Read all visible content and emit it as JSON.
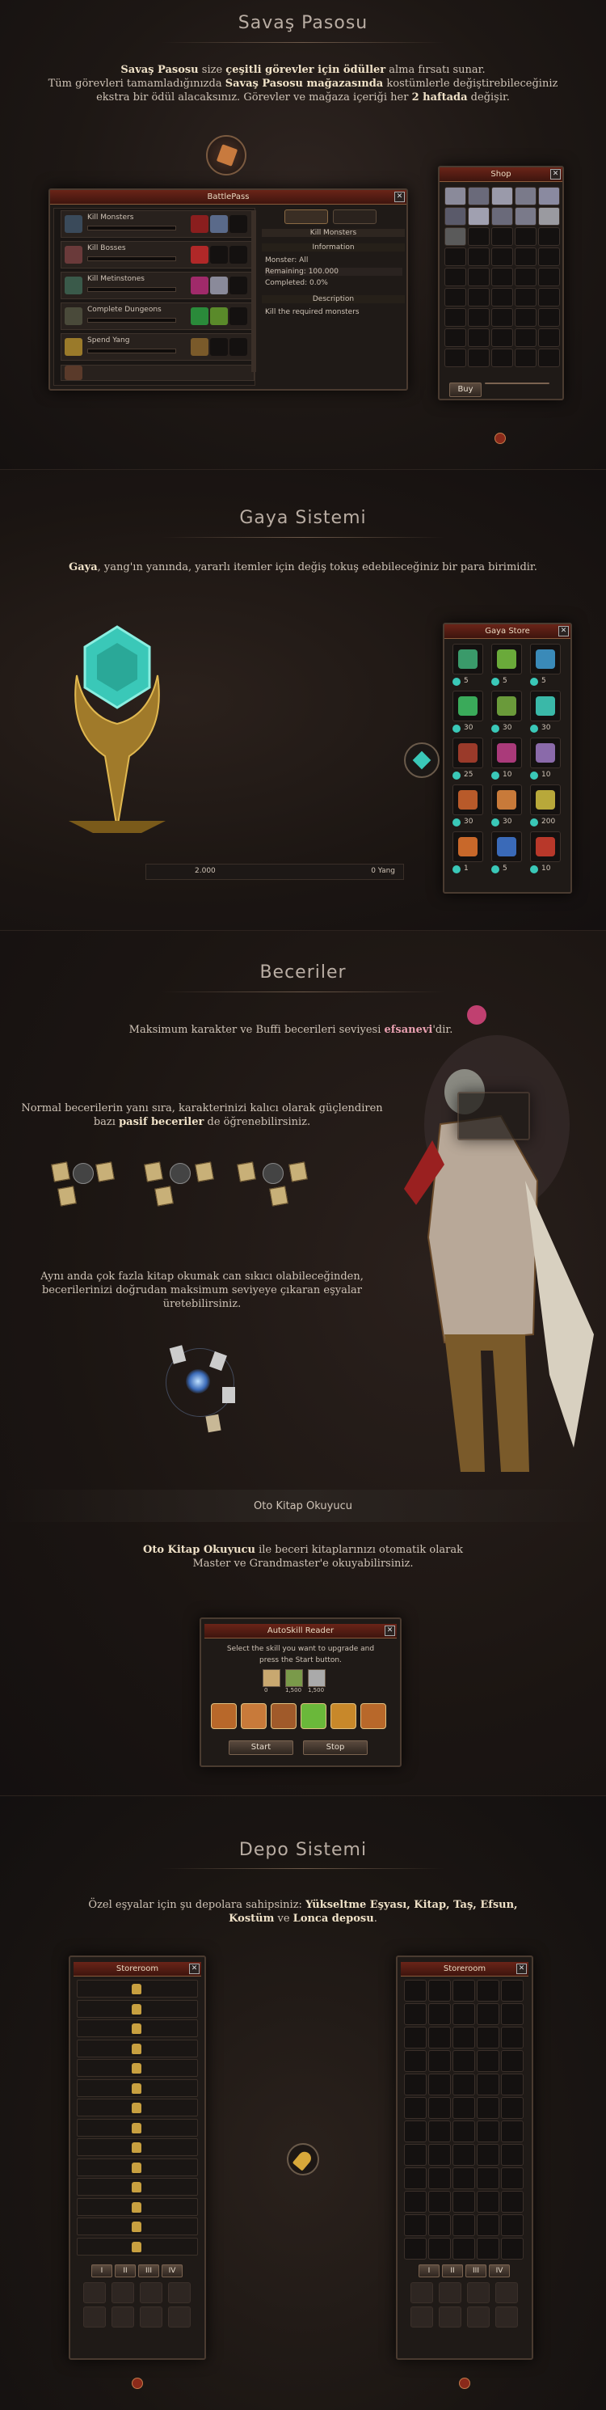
{
  "battlepass": {
    "heading": "Savaş Pasosu",
    "desc_line1_a": "Savaş Pasosu",
    "desc_line1_b": " size ",
    "desc_line1_c": "çeşitli görevler için ödüller",
    "desc_line1_d": " alma fırsatı sunar.",
    "desc_line2_a": "Tüm görevleri tamamladığınızda ",
    "desc_line2_b": "Savaş Pasosu mağazasında",
    "desc_line2_c": " kostümlerle değiştirebileceğiniz",
    "desc_line3_a": "ekstra bir ödül alacaksınız. Görevler ve mağaza içeriği her ",
    "desc_line3_b": "2 haftada",
    "desc_line3_c": " değişir.",
    "window_title": "BattlePass",
    "tasks": [
      "Kill Monsters",
      "Kill Bosses",
      "Kill Metinstones",
      "Complete Dungeons",
      "Spend Yang"
    ],
    "detail_header": "Kill Monsters",
    "info_header": "Information",
    "monster_label": "Monster: All",
    "remaining_label": "Remaining:",
    "remaining_value": "100.000",
    "completed_label": "Completed: 0.0%",
    "description_header": "Description",
    "description_text": "Kill the required monsters",
    "shop_title": "Shop",
    "buy_label": "Buy"
  },
  "gaya": {
    "heading": "Gaya Sistemi",
    "desc_a": "Gaya",
    "desc_b": ", yang'ın yanında, yararlı itemler için değiş tokuş edebileceğiniz bir para birimidir.",
    "store_title": "Gaya Store",
    "prices": [
      "5",
      "5",
      "5",
      "30",
      "30",
      "30",
      "25",
      "10",
      "10",
      "30",
      "30",
      "200",
      "1",
      "5",
      "10"
    ],
    "bar_left": "2.000",
    "bar_right": "0 Yang"
  },
  "skills": {
    "heading": "Beceriler",
    "line1_a": "Maksimum karakter ve Buffi becerileri seviyesi ",
    "line1_b": "efsanevi",
    "line1_c": "'dir.",
    "line2_a": "Normal becerilerin yanı sıra, karakterinizi kalıcı olarak güçlendiren",
    "line2_b": "bazı ",
    "line2_c": "pasif beceriler",
    "line2_d": " de öğrenebilirsiniz.",
    "line3_1": "Aynı anda çok fazla kitap okumak can sıkıcı olabileceğinden,",
    "line3_2": "becerilerinizi doğrudan maksimum seviyeye çıkaran eşyalar",
    "line3_3": "üretebilirsiniz.",
    "autobook_heading": "Oto Kitap Okuyucu",
    "autobook_a": "Oto Kitap Okuyucu",
    "autobook_b": " ile beceri kitaplarınızı otomatik olarak",
    "autobook_c": "Master ve Grandmaster'e okuyabilirsiniz.",
    "autoskill_title": "AutoSkill Reader",
    "autoskill_text1": "Select the skill you want to upgrade and",
    "autoskill_text2": "press the Start button.",
    "counts": [
      "0",
      "1,500",
      "1,500"
    ],
    "start_label": "Start",
    "stop_label": "Stop"
  },
  "depot": {
    "heading": "Depo Sistemi",
    "desc_a": "Özel eşyalar için şu depolara sahipsiniz: ",
    "desc_b": "Yükseltme Eşyası, Kitap, Taş, Efsun,",
    "desc_c": "Kostüm",
    "desc_d": " ve ",
    "desc_e": "Lonca deposu",
    "desc_f": ".",
    "storeroom_title_left": "Storeroom",
    "storeroom_title_right": "Storeroom",
    "page_tabs": [
      "I",
      "II",
      "III",
      "IV"
    ]
  },
  "colors": {
    "accent": "#6a2418",
    "text_highlight": "#f0e2c8",
    "legendary": "#e8a0b0"
  }
}
